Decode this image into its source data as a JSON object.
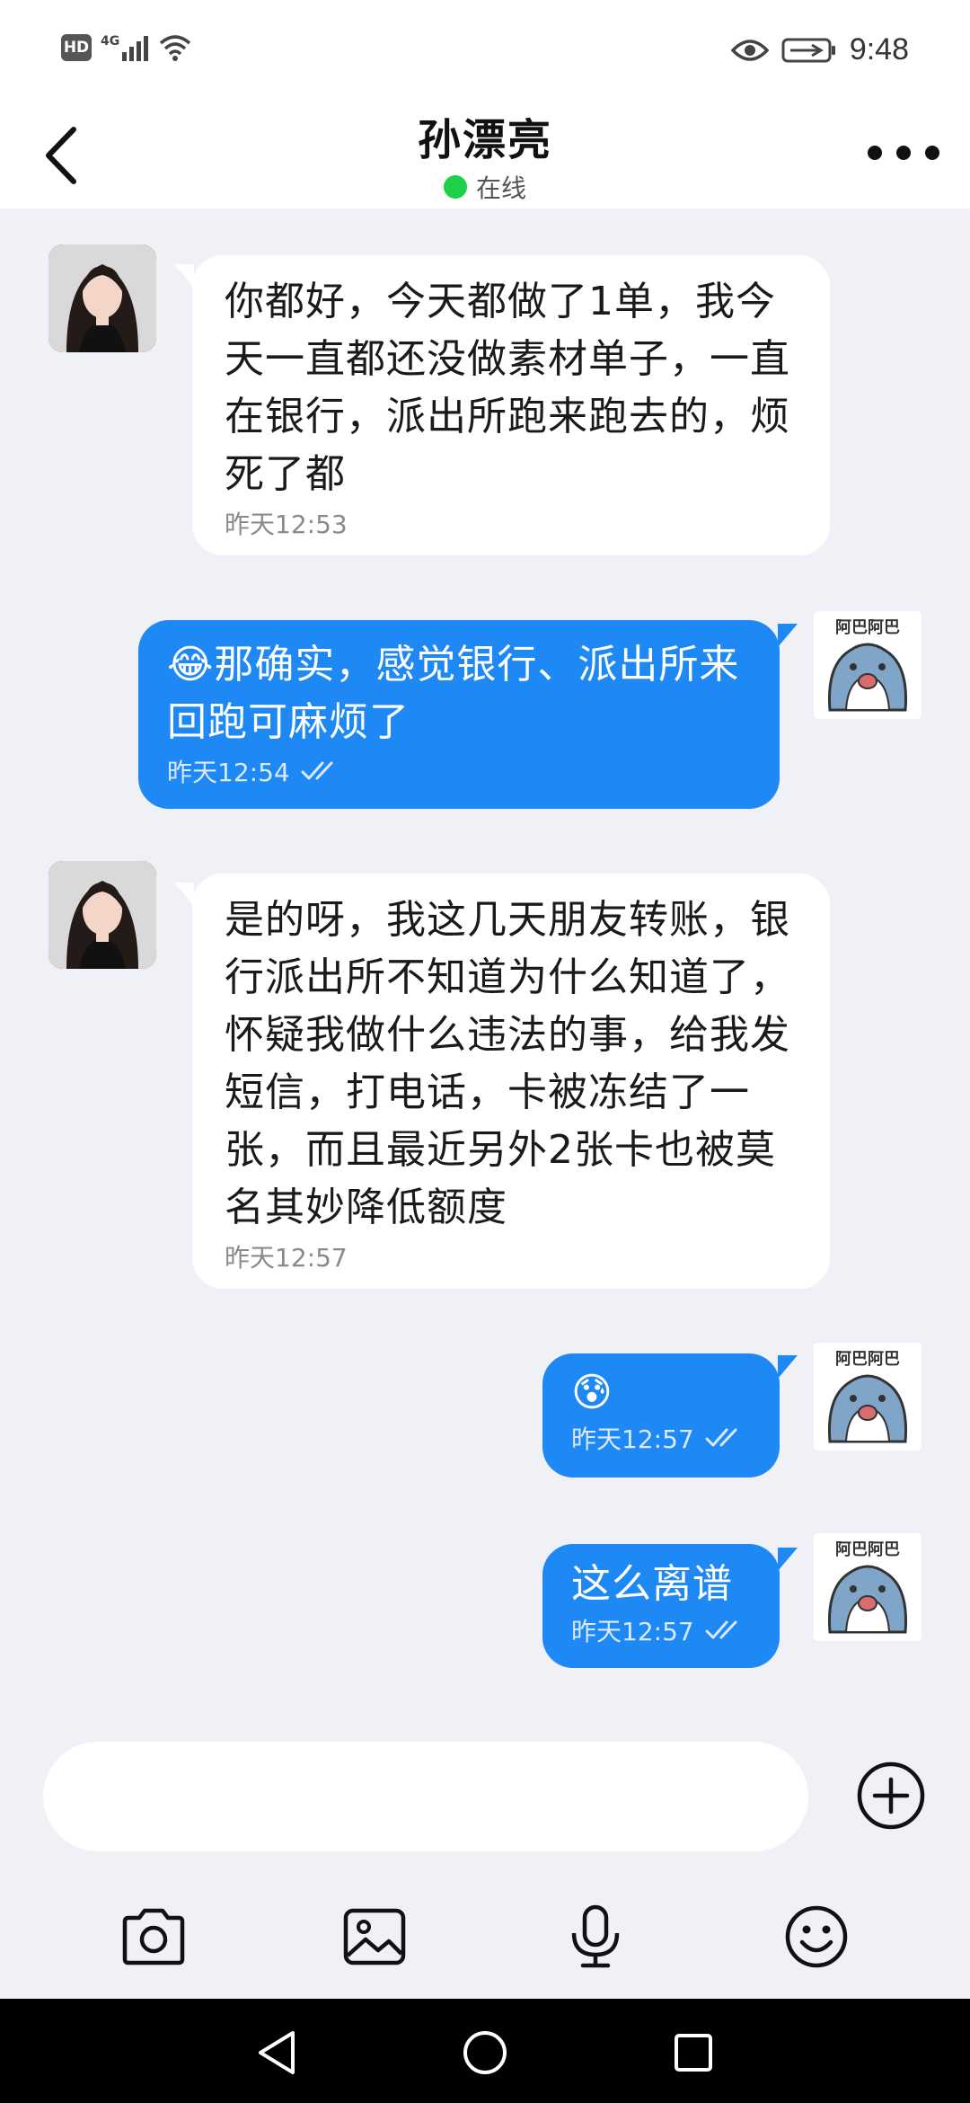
{
  "status_bar": {
    "left_badge": "HD",
    "network": "4G",
    "time": "9:48"
  },
  "header": {
    "title": "孙漂亮",
    "status": "在线"
  },
  "messages": [
    {
      "direction": "in",
      "text": "你都好，今天都做了1单，我今天一直都还没做素材单子，一直在银行，派出所跑来跑去的，烦死了都",
      "time": "昨天12:53"
    },
    {
      "direction": "out",
      "emoji": "😂",
      "text": "那确实，感觉银行、派出所来回跑可麻烦了",
      "time": "昨天12:54"
    },
    {
      "direction": "in",
      "text": "是的呀，我这几天朋友转账，银行派出所不知道为什么知道了，怀疑我做什么违法的事，给我发短信，打电话，卡被冻结了一张，而且最近另外2张卡也被莫名其妙降低额度",
      "time": "昨天12:57"
    },
    {
      "direction": "out",
      "emoji": "😰",
      "text": "",
      "time": "昨天12:57"
    },
    {
      "direction": "out",
      "text": "这么离谱",
      "time": "昨天12:57"
    }
  ],
  "sticker_text": "阿巴阿巴",
  "input": {
    "placeholder": ""
  },
  "colors": {
    "accent": "#1e88f5",
    "online": "#1ecf4a",
    "background": "#eff1f6"
  },
  "icons": [
    "back-arrow-icon",
    "more-icon",
    "eye-icon",
    "battery-icon",
    "plus-circle-icon",
    "camera-icon",
    "image-icon",
    "microphone-icon",
    "emoji-icon"
  ]
}
